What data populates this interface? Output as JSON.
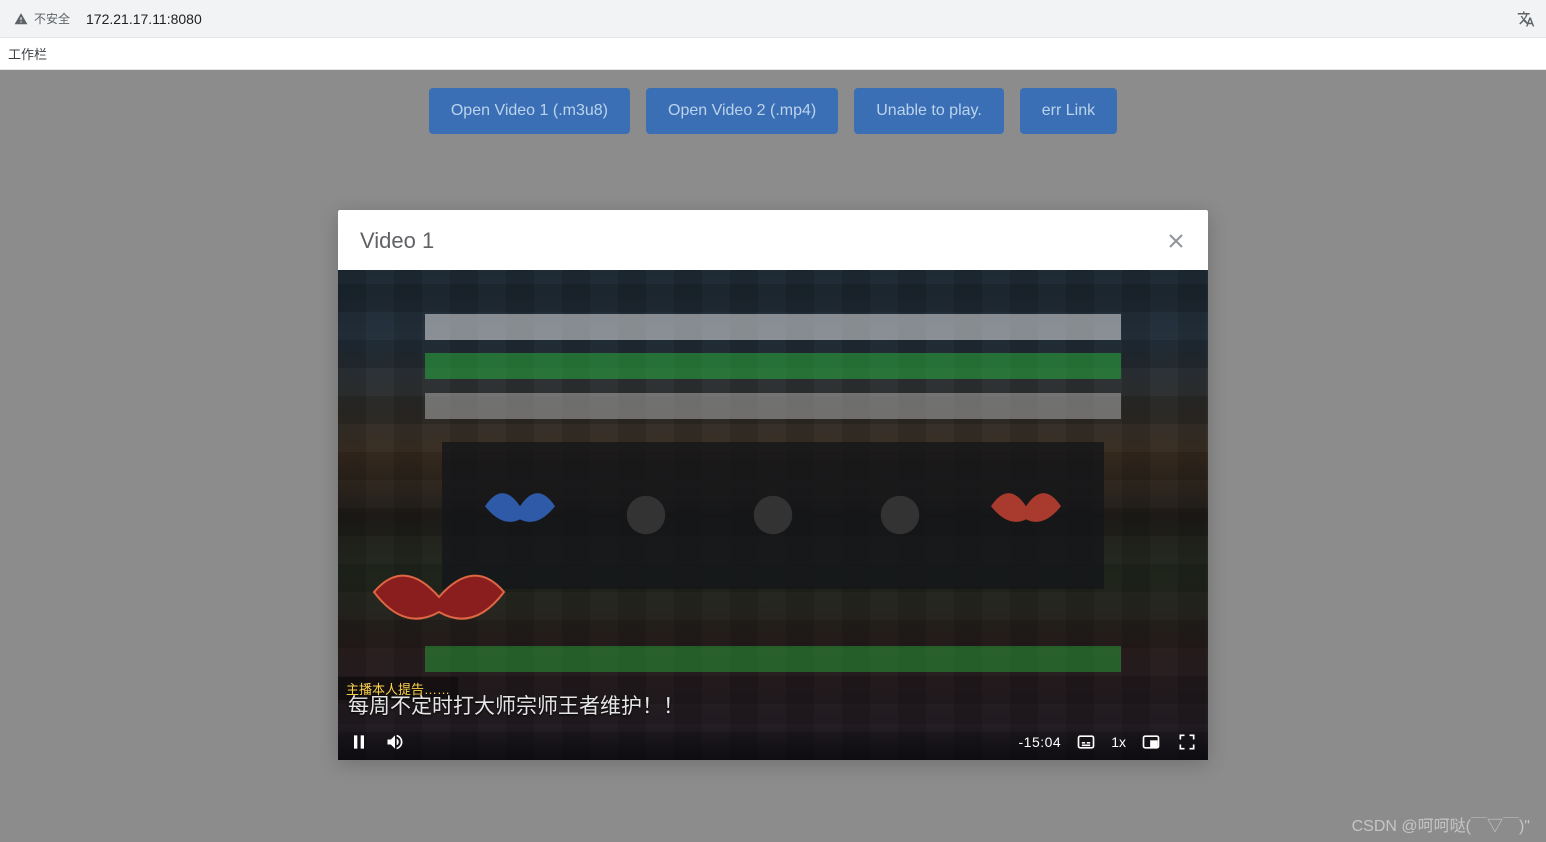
{
  "browser": {
    "security_label": "不安全",
    "url": "172.21.17.11:8080"
  },
  "bookmarks": {
    "label": "工作栏"
  },
  "buttons": {
    "video1": "Open Video 1 (.m3u8)",
    "video2": "Open Video 2 (.mp4)",
    "unable": "Unable to play.",
    "err": "err Link"
  },
  "modal": {
    "title": "Video 1"
  },
  "player": {
    "warn": "主播本人提告……",
    "caption": "每周不定时打大师宗师王者维护！！",
    "time_remaining": "-15:04",
    "rate": "1x"
  },
  "watermark": "CSDN @呵呵哒(￣▽￣)\""
}
